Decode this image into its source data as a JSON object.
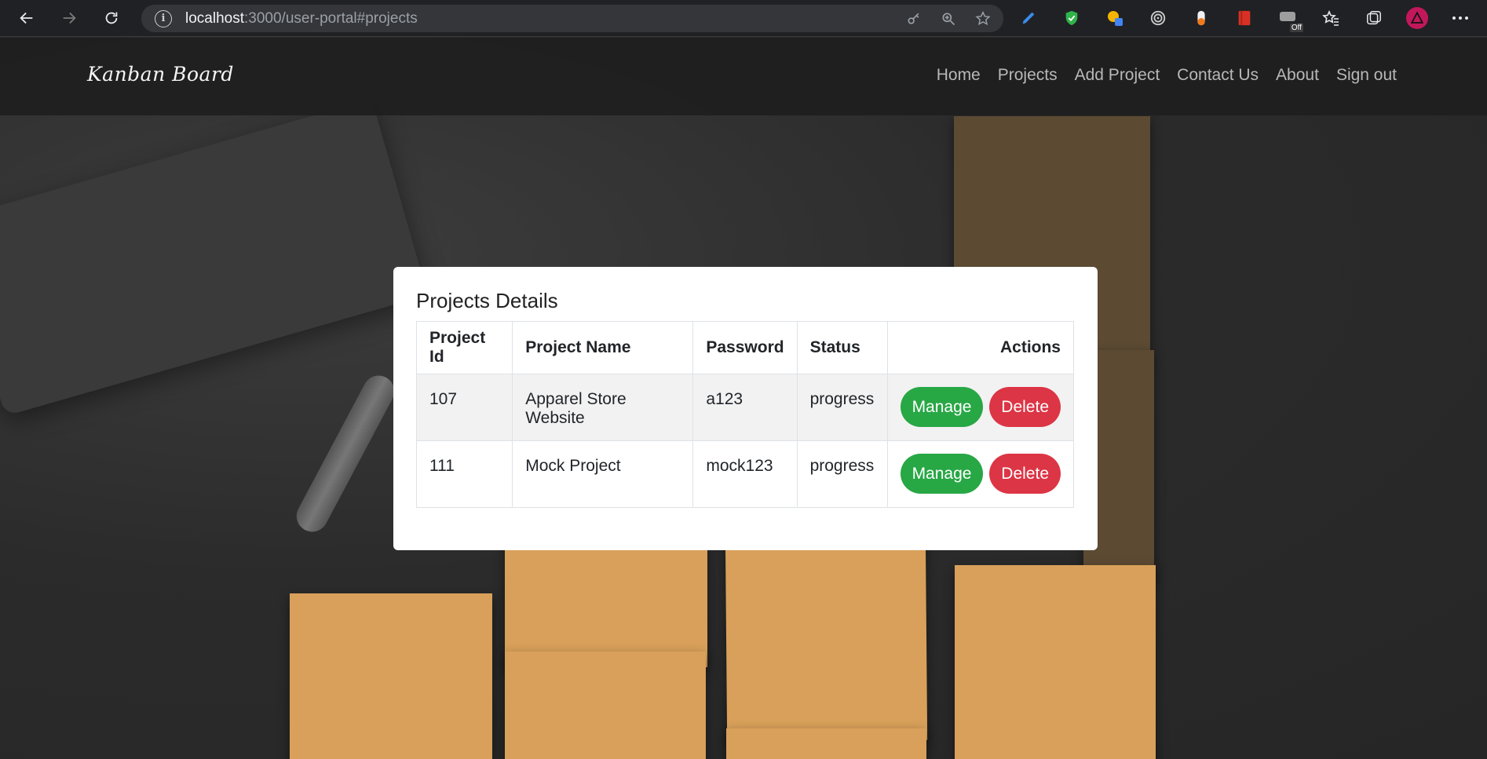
{
  "browser": {
    "url_host": "localhost",
    "url_path": ":3000/user-portal#projects",
    "ext_badge": "Off"
  },
  "navbar": {
    "brand": "Kanban Board",
    "links": [
      "Home",
      "Projects",
      "Add Project",
      "Contact Us",
      "About",
      "Sign out"
    ]
  },
  "card": {
    "title": "Projects Details",
    "columns": [
      "Project Id",
      "Project Name",
      "Password",
      "Status",
      "Actions"
    ],
    "rows": [
      {
        "id": "107",
        "name": "Apparel Store Website",
        "password": "a123",
        "status": "progress"
      },
      {
        "id": "111",
        "name": "Mock Project",
        "password": "mock123",
        "status": "progress"
      }
    ],
    "manage_label": "Manage",
    "delete_label": "Delete"
  },
  "colors": {
    "manage": "#28a745",
    "delete": "#dc3545",
    "sticky_note": "#d8a05a"
  }
}
